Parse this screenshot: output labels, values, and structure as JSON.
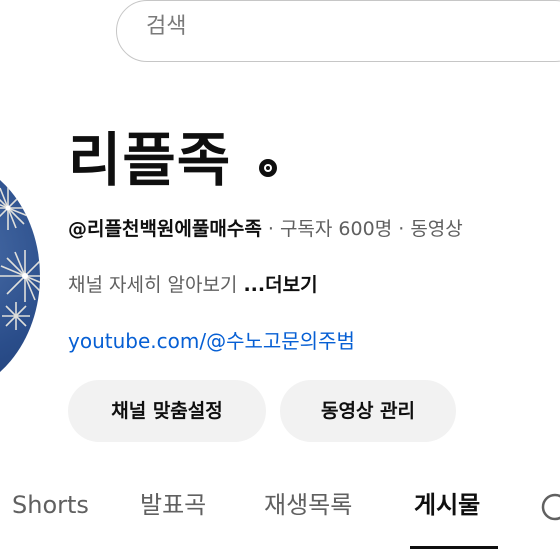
{
  "search": {
    "placeholder": "검색"
  },
  "channel": {
    "title": "리플족",
    "verified_icon": "verified-badge-icon",
    "handle": "@리플천백원에풀매수족",
    "subscribers": "구독자 600명",
    "separator": "·",
    "videos_partial": "동영상",
    "description": "채널 자세히 알아보기",
    "more_label": "...더보기",
    "link": "youtube.com/@수노고문의주범"
  },
  "buttons": {
    "customize_label": "채널 맞춤설정",
    "manage_label": "동영상 관리"
  },
  "tabs": {
    "shorts": "Shorts",
    "released": "발표곡",
    "playlists": "재생목록",
    "posts": "게시물",
    "active": "게시물",
    "next_icon": "partial-next-tab-icon"
  },
  "colors": {
    "link": "#065fd4",
    "button_bg": "#f2f2f2",
    "text_primary": "#0f0f0f",
    "text_secondary": "#606060"
  }
}
